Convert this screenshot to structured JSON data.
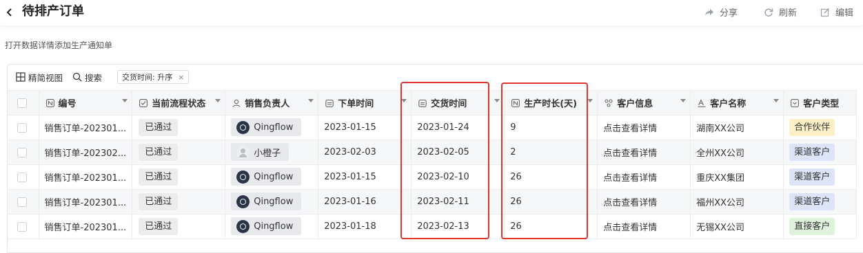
{
  "header": {
    "title": "待排产订单",
    "actions": {
      "share": "分享",
      "refresh": "刷新",
      "edit": "编辑"
    }
  },
  "subtitle": "打开数据详情添加生产通知单",
  "toolbar": {
    "view_label": "精简视图",
    "search_label": "搜索",
    "sort_tag": "交货时间: 升序",
    "sort_tag_close": "×"
  },
  "columns": [
    {
      "label": "编号",
      "icon": "number-icon"
    },
    {
      "label": "当前流程状态",
      "icon": "checkbox-icon"
    },
    {
      "label": "销售负责人",
      "icon": "person-icon"
    },
    {
      "label": "下单时间",
      "icon": "calendar-icon"
    },
    {
      "label": "交货时间",
      "icon": "calendar-icon"
    },
    {
      "label": "生产时长(天)",
      "icon": "number-icon"
    },
    {
      "label": "客户信息",
      "icon": "link-icon"
    },
    {
      "label": "客户名称",
      "icon": "text-icon"
    },
    {
      "label": "客户类型",
      "icon": "select-icon"
    }
  ],
  "rows": [
    {
      "id": "销售订单-202301...",
      "status": "已通过",
      "owner": "Qingflow",
      "owner_avatar": "dark",
      "order_date": "2023-01-15",
      "delivery_date": "2023-01-24",
      "duration": "9",
      "info": "点击查看详情",
      "customer": "湖南XX公司",
      "type": "合作伙伴",
      "type_class": "partner"
    },
    {
      "id": "销售订单-202302...",
      "status": "已通过",
      "owner": "小橙子",
      "owner_avatar": "light",
      "order_date": "2023-02-03",
      "delivery_date": "2023-02-05",
      "duration": "2",
      "info": "点击查看详情",
      "customer": "全州XX公司",
      "type": "渠道客户",
      "type_class": "channel"
    },
    {
      "id": "销售订单-202301...",
      "status": "已通过",
      "owner": "Qingflow",
      "owner_avatar": "dark",
      "order_date": "2023-01-15",
      "delivery_date": "2023-02-10",
      "duration": "26",
      "info": "点击查看详情",
      "customer": "重庆XX集团",
      "type": "渠道客户",
      "type_class": "channel"
    },
    {
      "id": "销售订单-202301...",
      "status": "已通过",
      "owner": "Qingflow",
      "owner_avatar": "dark",
      "order_date": "2023-01-16",
      "delivery_date": "2023-02-11",
      "duration": "26",
      "info": "点击查看详情",
      "customer": "福州XX公司",
      "type": "渠道客户",
      "type_class": "channel"
    },
    {
      "id": "销售订单-202301...",
      "status": "已通过",
      "owner": "Qingflow",
      "owner_avatar": "dark",
      "order_date": "2023-01-18",
      "delivery_date": "2023-02-13",
      "duration": "26",
      "info": "点击查看详情",
      "customer": "无锡XX公司",
      "type": "直接客户",
      "type_class": "direct"
    }
  ],
  "colors": {
    "highlight": "#e0332f",
    "partner": "#fdf0c6",
    "channel": "#dde4f8",
    "direct": "#dff2dc"
  }
}
